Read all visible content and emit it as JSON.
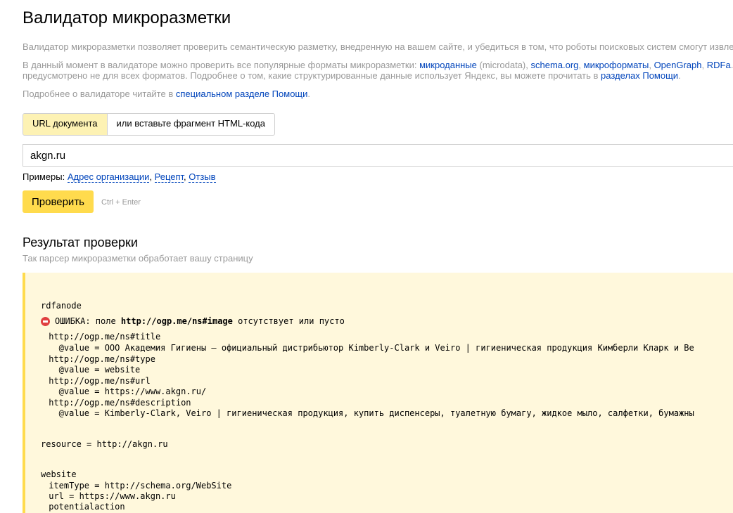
{
  "page_title": "Валидатор микроразметки",
  "intro": {
    "line1": "Валидатор микроразметки позволяет проверить семантическую разметку, внедренную на вашем сайте, и убедиться в том, что роботы поисковых систем смогут извле",
    "line2_prefix": "В данный момент в валидаторе можно проверить все популярные форматы микроразметки: ",
    "link_microdata": "микроданные",
    "microdata_note": " (microdata), ",
    "link_schema": "schema.org",
    "comma1": ", ",
    "link_microformats": "микроформаты",
    "comma2": ", ",
    "link_opengraph": "OpenGraph",
    "comma3": ", ",
    "link_rdfa": "RDFa",
    "dot": ".",
    "line3_prefix": "предусмотрено не для всех форматов. Подробнее о том, какие структурированные данные использует Яндекс, вы можете прочитать в ",
    "link_help_sections": "разделах Помощи",
    "line3_suffix": ".",
    "line4_prefix": "Подробнее о валидаторе читайте в ",
    "link_special": "специальном разделе Помощи",
    "line4_suffix": "."
  },
  "tabs": {
    "url": "URL документа",
    "html": "или вставьте фрагмент HTML-кода"
  },
  "input": {
    "value": "akgn.ru"
  },
  "examples": {
    "label": "Примеры: ",
    "items": [
      "Адрес организации",
      "Рецепт",
      "Отзыв"
    ],
    "sep": ", "
  },
  "check_button": "Проверить",
  "shortcut_hint": "Ctrl + Enter",
  "result": {
    "title": "Результат проверки",
    "subtitle": "Так парсер микроразметки обработает вашу страницу",
    "node_label": "rdfanode",
    "error_prefix": "ОШИБКА: поле ",
    "error_field": "http://ogp.me/ns#image",
    "error_suffix": " отсутствует или пусто",
    "lines": [
      " http://ogp.me/ns#title",
      "   @value = ООО Академия Гигиены — официальный дистрибьютор Kimberly-Clark и Veiro | гигиеническая продукция Кимберли Кларк и Ве",
      " http://ogp.me/ns#type",
      "   @value = website",
      " http://ogp.me/ns#url",
      "   @value = https://www.akgn.ru/",
      " http://ogp.me/ns#description",
      "   @value = Kimberly-Clark, Veiro | гигиеническая продукция, купить диспенсеры, туалетную бумагу, жидкое мыло, салфетки, бумажны"
    ],
    "resource_line": "resource = http://akgn.ru",
    "website_lines": [
      "website",
      " itemType = http://schema.org/WebSite",
      " url = https://www.akgn.ru",
      " potentialaction"
    ]
  },
  "colors": {
    "link": "#0044bb",
    "accent_yellow": "#ffdb4d",
    "result_bg": "#fff8dc",
    "muted_text": "#999999",
    "error_red": "#e04040"
  }
}
